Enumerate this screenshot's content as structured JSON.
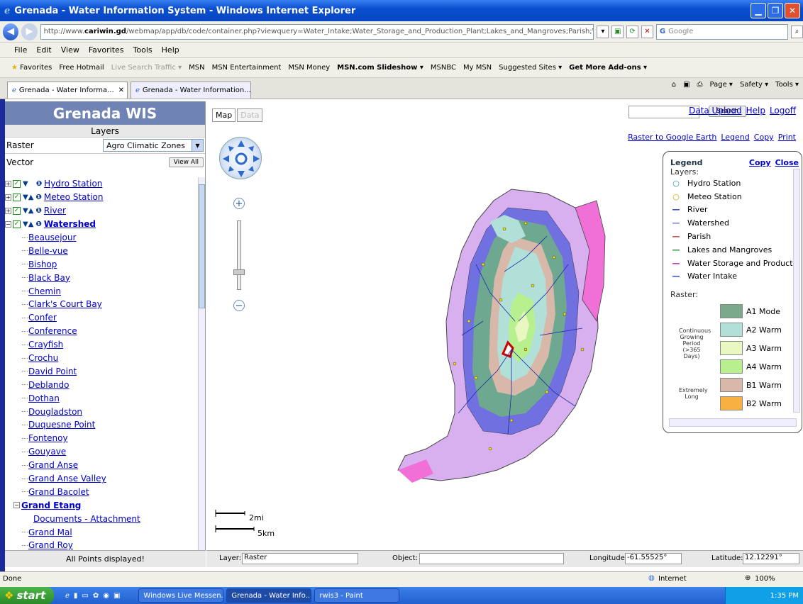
{
  "window": {
    "title": "Grenada - Water Information System - Windows Internet Explorer"
  },
  "address": {
    "url_prefix": "http://www.",
    "url_domain": "cariwin.gd",
    "url_rest": "/webmap/app/db/code/container.php?viewquery=Water_Intake;Water_Storage_and_Production_Plant;Lakes_and_Mangroves;Parish;Watershed;River;Meteo_Station;H",
    "search_placeholder": "Google"
  },
  "menu": [
    "File",
    "Edit",
    "View",
    "Favorites",
    "Tools",
    "Help"
  ],
  "favorites": {
    "label": "Favorites",
    "items": [
      "Free Hotmail",
      "Live Search Traffic ▾",
      "MSN",
      "MSN Entertainment",
      "MSN Money",
      "MSN.com Slideshow ▾",
      "MSNBC",
      "My MSN",
      "Suggested Sites ▾",
      "Get More Add-ons ▾"
    ]
  },
  "tabs": [
    "Grenada - Water Informa...",
    "Grenada - Water Information..."
  ],
  "commandbar": [
    "Page ▾",
    "Safety ▾",
    "Tools ▾"
  ],
  "app": {
    "title": "Grenada WIS",
    "layers_heading": "Layers",
    "raster_label": "Raster",
    "raster_selected": "Agro Climatic Zones",
    "vector_label": "Vector",
    "view_all": "View All",
    "vector_layers": [
      "Hydro Station",
      "Meteo Station",
      "River",
      "Watershed"
    ],
    "watersheds": [
      "Beausejour",
      "Belle-vue",
      "Bishop",
      "Black Bay",
      "Chemin",
      "Clark's Court Bay",
      "Confer",
      "Conference",
      "Crayfish",
      "Crochu",
      "David Point",
      "Deblando",
      "Dothan",
      "Dougladston",
      "Duquesne Point",
      "Fontenoy",
      "Gouyave",
      "Grand Anse",
      "Grand Anse Valley",
      "Grand Bacolet"
    ],
    "expanded_watershed": "Grand Etang",
    "expanded_child": "Documents - Attachment",
    "watersheds_after": [
      "Grand Mal",
      "Grand Roy"
    ],
    "status": "All Points displayed!"
  },
  "map": {
    "tab_map": "Map",
    "tab_data": "Data",
    "search_button": "Search",
    "top_links": [
      "Data Upload",
      "Help",
      "Logoff"
    ],
    "links": [
      "Raster to Google Earth",
      "Legend",
      "Copy",
      "Print"
    ],
    "scale_mi": "2mi",
    "scale_km": "5km"
  },
  "legend": {
    "title": "Legend",
    "copy": "Copy",
    "close": "Close",
    "layers_label": "Layers:",
    "items": [
      {
        "label": "Hydro Station",
        "symbol": "○",
        "color": "#1a9ab0"
      },
      {
        "label": "Meteo Station",
        "symbol": "○",
        "color": "#c8a800"
      },
      {
        "label": "River",
        "symbol": "—",
        "color": "#2233cc"
      },
      {
        "label": "Watershed",
        "symbol": "—",
        "color": "#6677cc"
      },
      {
        "label": "Parish",
        "symbol": "—",
        "color": "#cc3333"
      },
      {
        "label": "Lakes and Mangroves",
        "symbol": "—",
        "color": "#228833"
      },
      {
        "label": "Water Storage and Product",
        "symbol": "—",
        "color": "#aa22aa"
      },
      {
        "label": "Water Intake",
        "symbol": "—",
        "color": "#2233cc"
      }
    ],
    "raster_label": "Raster:",
    "group1": "Continuous Growing Period (>365 Days)",
    "group2": "Extremely Long",
    "raster_items": [
      {
        "label": "A1 Mode",
        "color": "#7aaa8a"
      },
      {
        "label": "A2 Warm",
        "color": "#b0e0d8"
      },
      {
        "label": "A3 Warm",
        "color": "#e8f8c0"
      },
      {
        "label": "A4 Warm",
        "color": "#b8f090"
      },
      {
        "label": "B1 Warm",
        "color": "#d8b8a8"
      },
      {
        "label": "B2 Warm",
        "color": "#f8b040"
      }
    ]
  },
  "bottom": {
    "layer_label": "Layer:",
    "layer_value": "Raster",
    "object_label": "Object:",
    "object_value": "",
    "longitude_label": "Longitude:",
    "longitude_value": "-61.55525°",
    "latitude_label": "Latitude:",
    "latitude_value": "12.12291°"
  },
  "ie_status": {
    "left": "Done",
    "zone": "Internet",
    "zoom": "100%"
  },
  "taskbar": {
    "start": "start",
    "items": [
      "Windows Live Messen...",
      "Grenada - Water Info...",
      "rwis3 - Paint"
    ],
    "clock": "1:35 PM"
  }
}
